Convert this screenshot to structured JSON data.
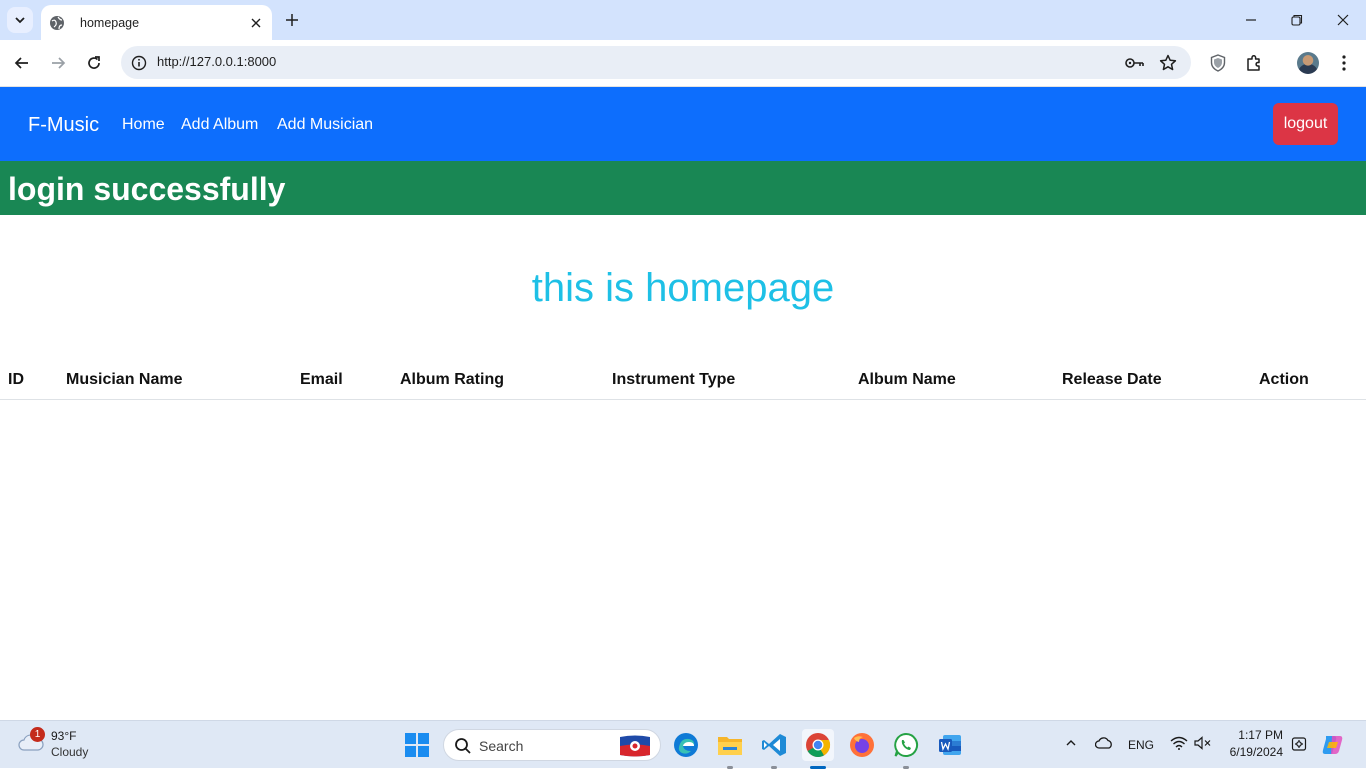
{
  "browser": {
    "tab_title": "homepage",
    "url": "http://127.0.0.1:8000"
  },
  "navbar": {
    "brand": "F-Music",
    "links": [
      "Home",
      "Add Album",
      "Add Musician"
    ],
    "logout_label": "logout",
    "color": "#0d6efd"
  },
  "alert": {
    "message": "login successfully",
    "color": "#198754"
  },
  "main": {
    "heading": "this is homepage",
    "heading_color": "#1ec0e6"
  },
  "table": {
    "headers": [
      "ID",
      "Musician Name",
      "Email",
      "Album Rating",
      "Instrument Type",
      "Album Name",
      "Release Date",
      "Action"
    ],
    "rows": []
  },
  "taskbar": {
    "weather_temp": "93°F",
    "weather_condition": "Cloudy",
    "notification_count": "1",
    "search_placeholder": "Search",
    "language": "ENG",
    "time": "1:17 PM",
    "date": "6/19/2024"
  }
}
